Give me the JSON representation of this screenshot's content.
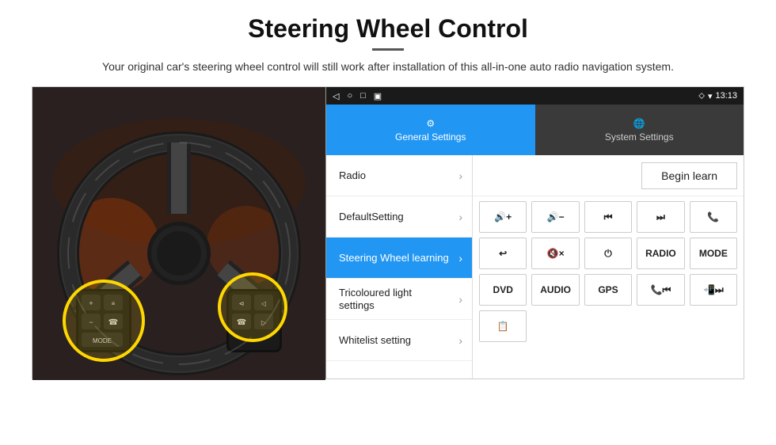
{
  "header": {
    "title": "Steering Wheel Control",
    "subtitle": "Your original car's steering wheel control will still work after installation of this all-in-one auto radio navigation system.",
    "divider": true
  },
  "status_bar": {
    "nav_icons": [
      "◁",
      "○",
      "□",
      "▣"
    ],
    "right_icons": "♦ ▾",
    "time": "13:13"
  },
  "tabs": [
    {
      "id": "general",
      "label": "General Settings",
      "icon": "⚙",
      "active": true
    },
    {
      "id": "system",
      "label": "System Settings",
      "icon": "🌐",
      "active": false
    }
  ],
  "menu_items": [
    {
      "label": "Radio",
      "active": false
    },
    {
      "label": "DefaultSetting",
      "active": false
    },
    {
      "label": "Steering Wheel learning",
      "active": true
    },
    {
      "label": "Tricoloured light settings",
      "active": false
    },
    {
      "label": "Whitelist setting",
      "active": false
    }
  ],
  "begin_learn_label": "Begin learn",
  "control_rows": [
    [
      {
        "label": "🔊+",
        "type": "icon"
      },
      {
        "label": "🔊−",
        "type": "icon"
      },
      {
        "label": "⏮",
        "type": "icon"
      },
      {
        "label": "⏭",
        "type": "icon"
      },
      {
        "label": "📞",
        "type": "icon"
      }
    ],
    [
      {
        "label": "↩",
        "type": "icon"
      },
      {
        "label": "🔇×",
        "type": "icon"
      },
      {
        "label": "⏻",
        "type": "icon"
      },
      {
        "label": "RADIO",
        "type": "text"
      },
      {
        "label": "MODE",
        "type": "text"
      }
    ],
    [
      {
        "label": "DVD",
        "type": "text"
      },
      {
        "label": "AUDIO",
        "type": "text"
      },
      {
        "label": "GPS",
        "type": "text"
      },
      {
        "label": "📞⏮",
        "type": "icon"
      },
      {
        "label": "📲⏭",
        "type": "icon"
      }
    ]
  ],
  "bottom_icon_label": "📋"
}
